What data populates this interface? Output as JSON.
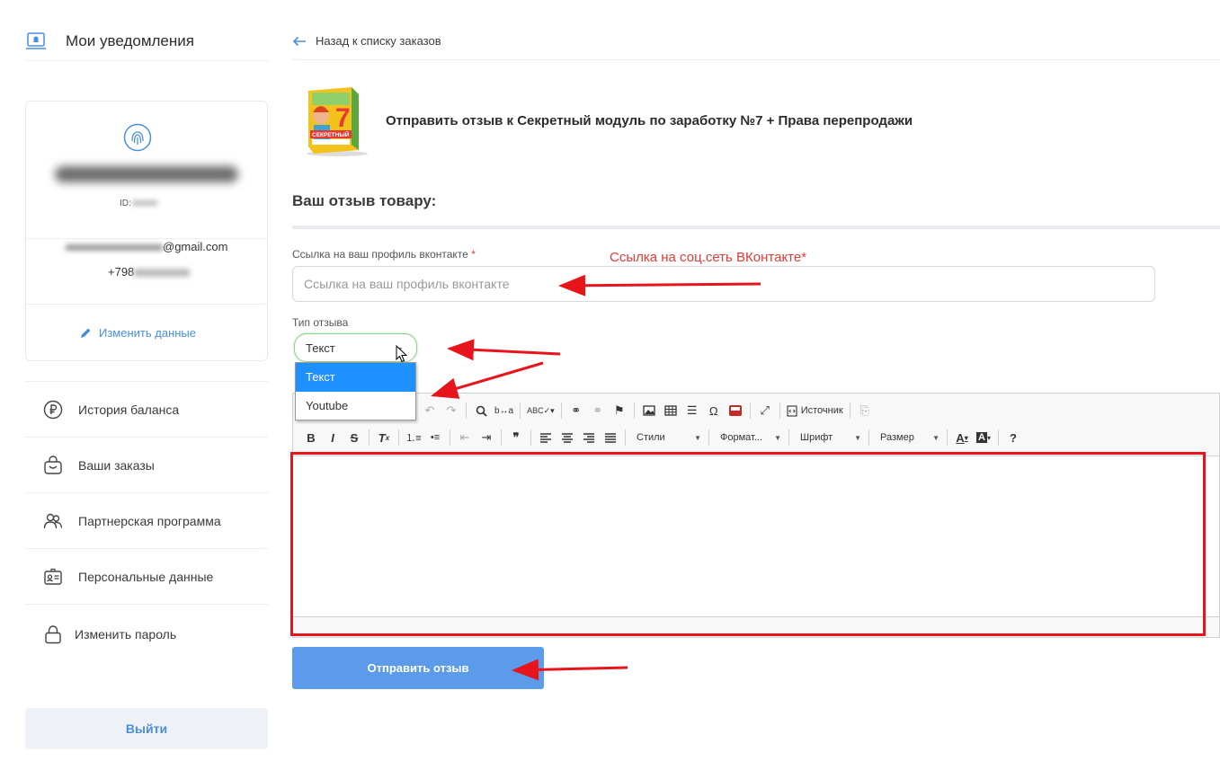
{
  "sidebar": {
    "notifications_title": "Мои уведомления",
    "profile": {
      "id_label": "ID:",
      "email_suffix": "@gmail.com",
      "phone_prefix": "+798",
      "edit_label": "Изменить данные"
    },
    "menu": [
      {
        "label": "История баланса",
        "icon": "ruble-icon"
      },
      {
        "label": "Ваши заказы",
        "icon": "shopping-bag-icon"
      },
      {
        "label": "Партнерская программа",
        "icon": "users-icon"
      },
      {
        "label": "Персональные данные",
        "icon": "id-card-icon"
      },
      {
        "label": "Изменить пароль",
        "icon": "lock-icon"
      }
    ],
    "logout_label": "Выйти"
  },
  "main": {
    "back_label": "Назад к списку заказов",
    "product_title": "Отправить отзыв к Секретный модуль по заработку №7 + Права перепродажи",
    "product_image_text": "СЕКРЕТНЫЙ",
    "product_image_number": "7",
    "review_heading": "Ваш отзыв товару:",
    "vk_field": {
      "label": "Ссылка на ваш профиль вконтакте",
      "required_mark": "*",
      "placeholder": "Ссылка на ваш профиль вконтакте",
      "value": ""
    },
    "annotation": "Ссылка на соц.сеть ВКонтакте*",
    "type_field": {
      "label": "Тип отзыва",
      "selected": "Текст",
      "options": [
        "Текст",
        "Youtube"
      ]
    },
    "editor": {
      "source_label": "Источник",
      "styles_label": "Стили",
      "format_label": "Формат...",
      "font_label": "Шрифт",
      "size_label": "Размер",
      "bold": "B",
      "italic": "I",
      "strike": "S",
      "help": "?",
      "omega": "Ω",
      "quote": "❞"
    },
    "submit_label": "Отправить отзыв"
  },
  "colors": {
    "accent": "#4a8fdc",
    "button": "#5b9bea",
    "annotation_red": "#e8141c",
    "dropdown_selected": "#1e90ff"
  }
}
